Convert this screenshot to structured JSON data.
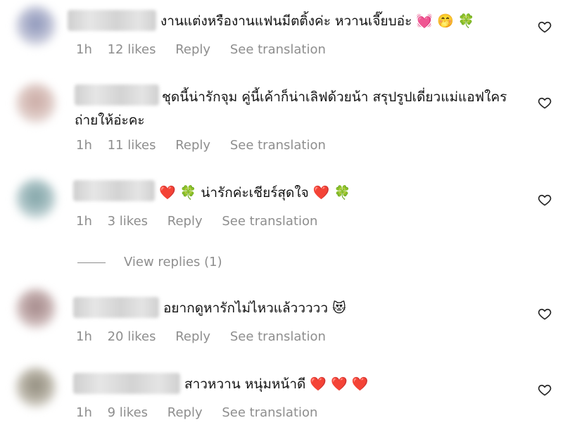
{
  "comments": [
    {
      "text": "งานแต่งหรืองานแฟนมีตติ้งค่ะ หวานเจี๊ยบอ่ะ 💓 🤭 🍀",
      "time": "1h",
      "likes": "12 likes",
      "reply": "Reply",
      "translate": "See translation"
    },
    {
      "text": "ชุดนี้น่ารักจุม คู่นี้เค้าก็น่าเลิฟด้วยน้า สรุปรูปเดี่ยวแม่แอฟใครถ่ายให้อ่ะคะ",
      "time": "1h",
      "likes": "11 likes",
      "reply": "Reply",
      "translate": "See translation"
    },
    {
      "text": "❤️ 🍀 น่ารักค่ะเชียร์สุดใจ ❤️ 🍀",
      "time": "1h",
      "likes": "3 likes",
      "reply": "Reply",
      "translate": "See translation"
    },
    {
      "text": "อยากดูหารักไม่ไหวแล้ววววว 😻",
      "time": "1h",
      "likes": "20 likes",
      "reply": "Reply",
      "translate": "See translation"
    },
    {
      "text": "สาวหวาน หนุ่มหน้าดี ❤️ ❤️ ❤️",
      "time": "1h",
      "likes": "9 likes",
      "reply": "Reply",
      "translate": "See translation"
    }
  ],
  "view_replies": "View replies (1)",
  "icons": {
    "like": "heart-outline-icon"
  },
  "colors": {
    "meta_text": "#8e8e8e",
    "body_text": "#111111"
  }
}
